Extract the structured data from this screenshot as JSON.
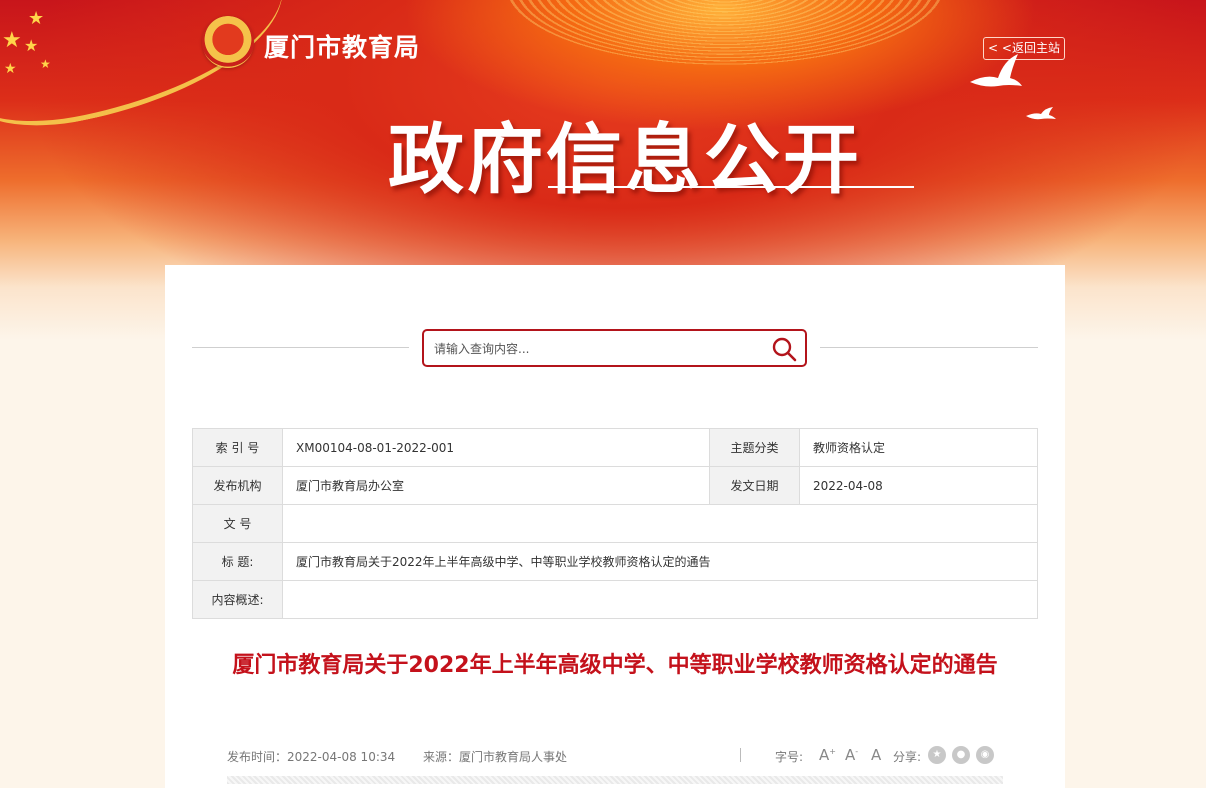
{
  "header": {
    "site_name": "厦门市教育局",
    "back_link": "< <返回主站",
    "hero_title": "政府信息公开"
  },
  "search": {
    "placeholder": "请输入查询内容..."
  },
  "meta_table": {
    "index_label": "索 引 号",
    "index_value": "XM00104-08-01-2022-001",
    "topic_label": "主题分类",
    "topic_value": "教师资格认定",
    "publisher_label": "发布机构",
    "publisher_value": "厦门市教育局办公室",
    "date_label": "发文日期",
    "date_value": "2022-04-08",
    "docno_label": "文 号",
    "docno_value": "",
    "title_label": "标 题:",
    "title_value": "厦门市教育局关于2022年上半年高级中学、中等职业学校教师资格认定的通告",
    "summary_label": "内容概述:",
    "summary_value": ""
  },
  "article": {
    "title": "厦门市教育局关于2022年上半年高级中学、中等职业学校教师资格认定的通告",
    "publish_time": "发布时间：2022-04-08 10:34",
    "source": "来源：厦门市教育局人事处",
    "font_size_label": "字号:",
    "font_large": "A",
    "font_medium": "A",
    "font_small": "A",
    "share_label": "分享:"
  },
  "colors": {
    "accent": "#c4111b",
    "border": "#b3141b"
  }
}
